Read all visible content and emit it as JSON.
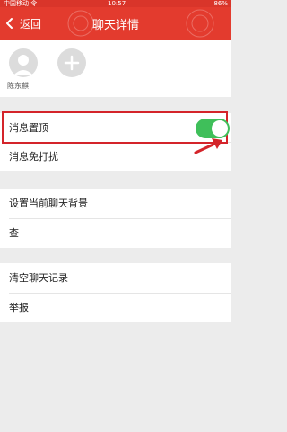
{
  "status_bar": {
    "carrier": "中国移动 令",
    "time": "10:57",
    "battery": "86%"
  },
  "nav": {
    "back_label": "返回",
    "title": "聊天详情"
  },
  "members": [
    {
      "name": "陈东麒"
    }
  ],
  "settings": {
    "top_chat": "消息置顶",
    "top_chat_enabled": true,
    "mute": "消息免打扰",
    "set_background": "设置当前聊天背景",
    "find_history": "查",
    "clear_history": "清空聊天记录",
    "report": "举报"
  },
  "colors": {
    "header": "#e33b2e",
    "toggle_on": "#3fbf5a",
    "annotation": "#d4242a"
  }
}
